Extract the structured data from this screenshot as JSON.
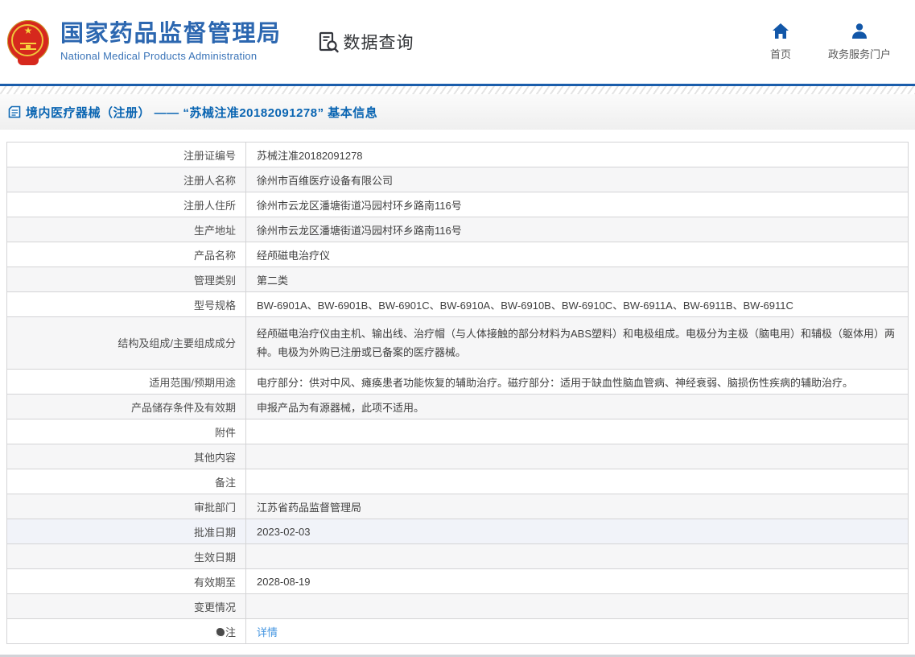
{
  "header": {
    "brand": {
      "title": "国家药品监督管理局",
      "subtitle": "National Medical Products Administration"
    },
    "search": {
      "label": "数据查询"
    },
    "nav": [
      {
        "label": "首页",
        "icon": "home-icon"
      },
      {
        "label": "政务服务门户",
        "icon": "user-icon"
      }
    ]
  },
  "breadcrumb": {
    "title": "境内医疗器械（注册） —— “苏械注准20182091278” 基本信息"
  },
  "table": {
    "rows": [
      {
        "label": "注册证编号",
        "value": "苏械注准20182091278",
        "shaded": false
      },
      {
        "label": "注册人名称",
        "value": "徐州市百维医疗设备有限公司",
        "shaded": true
      },
      {
        "label": "注册人住所",
        "value": "徐州市云龙区潘塘街道冯园村环乡路南116号",
        "shaded": false
      },
      {
        "label": "生产地址",
        "value": "徐州市云龙区潘塘街道冯园村环乡路南116号",
        "shaded": true
      },
      {
        "label": "产品名称",
        "value": "经颅磁电治疗仪",
        "shaded": false
      },
      {
        "label": "管理类别",
        "value": "第二类",
        "shaded": true
      },
      {
        "label": "型号规格",
        "value": "BW-6901A、BW-6901B、BW-6901C、BW-6910A、BW-6910B、BW-6910C、BW-6911A、BW-6911B、BW-6911C",
        "shaded": false
      },
      {
        "label": "结构及组成/主要组成成分",
        "value": "经颅磁电治疗仪由主机、输出线、治疗帽（与人体接触的部分材料为ABS塑料）和电极组成。电极分为主极（脑电用）和辅极（躯体用）两种。电极为外购已注册或已备案的医疗器械。",
        "shaded": true,
        "tall": true
      },
      {
        "label": "适用范围/预期用途",
        "value": "电疗部分：供对中风、瘫痪患者功能恢复的辅助治疗。磁疗部分：适用于缺血性脑血管病、神经衰弱、脑损伤性疾病的辅助治疗。",
        "shaded": false
      },
      {
        "label": "产品储存条件及有效期",
        "value": "申报产品为有源器械，此项不适用。",
        "shaded": true
      },
      {
        "label": "附件",
        "value": "",
        "shaded": false
      },
      {
        "label": "其他内容",
        "value": "",
        "shaded": true
      },
      {
        "label": "备注",
        "value": "",
        "shaded": false
      },
      {
        "label": "审批部门",
        "value": "江苏省药品监督管理局",
        "shaded": true
      },
      {
        "label": "批准日期",
        "value": "2023-02-03",
        "shaded": false,
        "highlight": true
      },
      {
        "label": "生效日期",
        "value": "",
        "shaded": true
      },
      {
        "label": "有效期至",
        "value": "2028-08-19",
        "shaded": false
      },
      {
        "label": "变更情况",
        "value": "",
        "shaded": true
      },
      {
        "label": "注",
        "value": "详情",
        "shaded": false,
        "link": true,
        "icon": "note-dot"
      }
    ]
  },
  "colors": {
    "brand_blue": "#2c67b0",
    "line_blue": "#1a5dab",
    "title_blue": "#0a65b2",
    "link_blue": "#4495e0",
    "icon_blue": "#1257a8",
    "shaded_row": "#f6f6f7",
    "highlight_row": "#f1f3f9",
    "emblem_red": "#d6281d",
    "emblem_gold": "#f6d23e"
  }
}
